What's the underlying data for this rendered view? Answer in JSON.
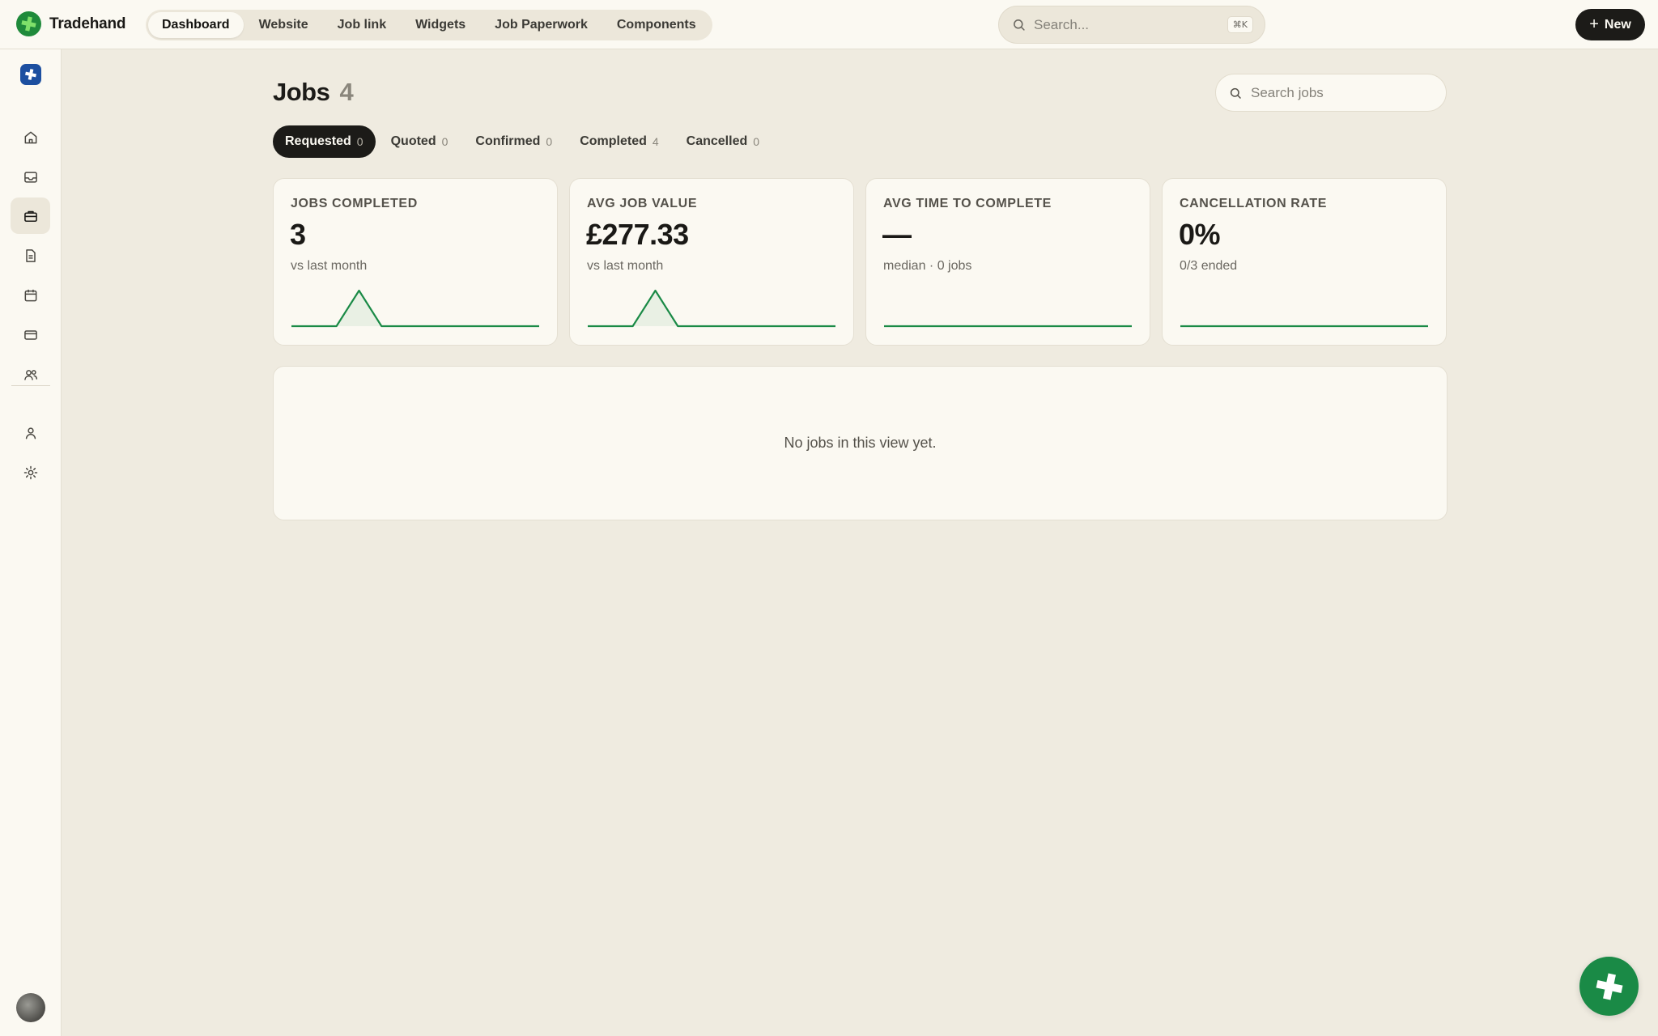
{
  "app": {
    "name": "Tradehand"
  },
  "topnav": {
    "tabs": [
      {
        "label": "Dashboard"
      },
      {
        "label": "Website"
      },
      {
        "label": "Job link"
      },
      {
        "label": "Widgets"
      },
      {
        "label": "Job Paperwork"
      },
      {
        "label": "Components"
      }
    ],
    "active": "Dashboard",
    "search_placeholder": "Search...",
    "search_shortcut": "⌘K",
    "new_label": "New"
  },
  "sidebar": {
    "items": [
      {
        "icon": "home-icon"
      },
      {
        "icon": "inbox-icon"
      },
      {
        "icon": "briefcase-icon",
        "active": true
      },
      {
        "icon": "document-icon"
      },
      {
        "icon": "calendar-icon"
      },
      {
        "icon": "credit-card-icon"
      },
      {
        "icon": "users-icon"
      },
      {
        "icon": "user-icon"
      },
      {
        "icon": "settings-icon"
      }
    ]
  },
  "page": {
    "title": "Jobs",
    "count": "4",
    "search_placeholder": "Search jobs"
  },
  "status_tabs": [
    {
      "label": "Requested",
      "count": "0",
      "active": true
    },
    {
      "label": "Quoted",
      "count": "0"
    },
    {
      "label": "Confirmed",
      "count": "0"
    },
    {
      "label": "Completed",
      "count": "4"
    },
    {
      "label": "Cancelled",
      "count": "0"
    }
  ],
  "stats": [
    {
      "label": "JOBS COMPLETED",
      "value": "3",
      "sub": "vs last month",
      "trend": [
        0,
        0,
        0,
        1,
        0,
        0,
        0,
        0,
        0,
        0,
        0,
        0
      ]
    },
    {
      "label": "AVG JOB VALUE",
      "value": "£277.33",
      "sub": "vs last month",
      "trend": [
        0,
        0,
        0,
        1,
        0,
        0,
        0,
        0,
        0,
        0,
        0,
        0
      ]
    },
    {
      "label": "AVG TIME TO COMPLETE",
      "value": "—",
      "sub": "median · 0 jobs",
      "trend": [
        0,
        0,
        0,
        0,
        0,
        0,
        0,
        0,
        0,
        0,
        0,
        0
      ]
    },
    {
      "label": "CANCELLATION RATE",
      "value": "0%",
      "sub": "0/3 ended",
      "trend": [
        0,
        0,
        0,
        0,
        0,
        0,
        0,
        0,
        0,
        0,
        0,
        0
      ]
    }
  ],
  "empty_state": {
    "text": "No jobs in this view yet."
  },
  "colors": {
    "accent": "#1a8a46",
    "dark": "#1c1b18",
    "background": "#efebe0",
    "surface": "#fbf9f2"
  }
}
